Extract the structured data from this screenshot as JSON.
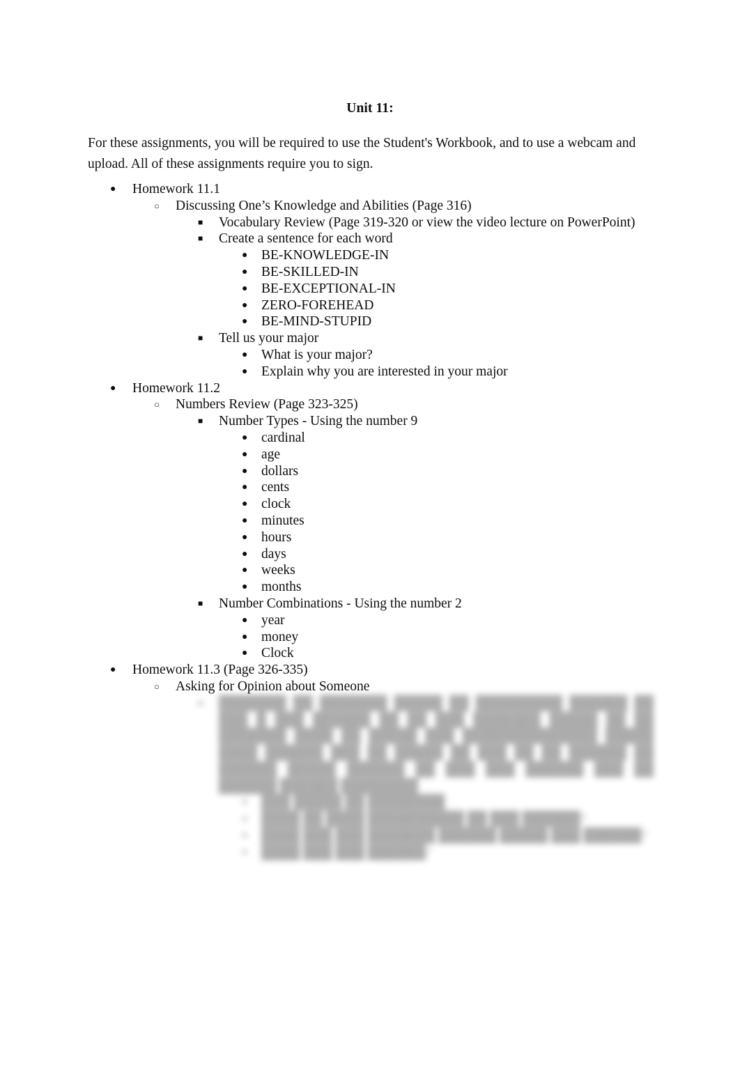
{
  "document": {
    "title": "Unit 11:",
    "intro": "For these assignments, you will be required to use the Student's Workbook, and to use a webcam and upload. All of these assignments require you to sign."
  },
  "outline": {
    "hw1": {
      "label": "Homework 11.1",
      "sub": "Discussing One’s Knowledge and Abilities (Page 316)",
      "vocab": "Vocabulary Review (Page 319-320 or view the video lecture on PowerPoint)",
      "sentence": "Create a sentence for each word",
      "words": [
        "BE-KNOWLEDGE-IN",
        "BE-SKILLED-IN",
        "BE-EXCEPTIONAL-IN",
        "ZERO-FOREHEAD",
        "BE-MIND-STUPID"
      ],
      "major": "Tell us your major",
      "major_questions": [
        "What is your major?",
        "Explain why you are interested in your major"
      ]
    },
    "hw2": {
      "label": "Homework 11.2",
      "sub": "Numbers Review (Page 323-325)",
      "types_heading": "Number Types - Using the number 9",
      "types": [
        "cardinal",
        "age",
        "dollars",
        "cents",
        "clock",
        "minutes",
        "hours",
        "days",
        "weeks",
        "months"
      ],
      "combos_heading": "Number Combinations - Using the number 2",
      "combos": [
        "year",
        "money",
        "Clock"
      ]
    },
    "hw3": {
      "label": "Homework 11.3 (Page 326-335)",
      "sub": "Asking for Opinion about Someone",
      "redacted": {
        "note": "blurred-unreadable-text",
        "paragraph": "███████ ██ ███████ █████ ██ █████████ ██████ ██ ███ █ ███ ██████ ██ ██ ███ ███████ █████ ██ ██ ███████ ████ ██ █████ ███ ██████████████ █████ ████ ██████ ███ ██ █████ ██ ███ ██ ██ ██████ ██ ██████ █████ ██████ ██ ███ ███ ██████ ███ ██ ██████ ██████ ████████",
        "items": [
          "███ █████ ██ ████████",
          "████ ██ ████ ██████████ ██ ███ ██████?",
          "████ ███ ███ ███████ ██████ █████ ███ ██████?",
          "████ ███ ███ ██████?"
        ]
      }
    }
  },
  "bullets": {
    "disc": "●",
    "circle": "○",
    "square": "■"
  }
}
